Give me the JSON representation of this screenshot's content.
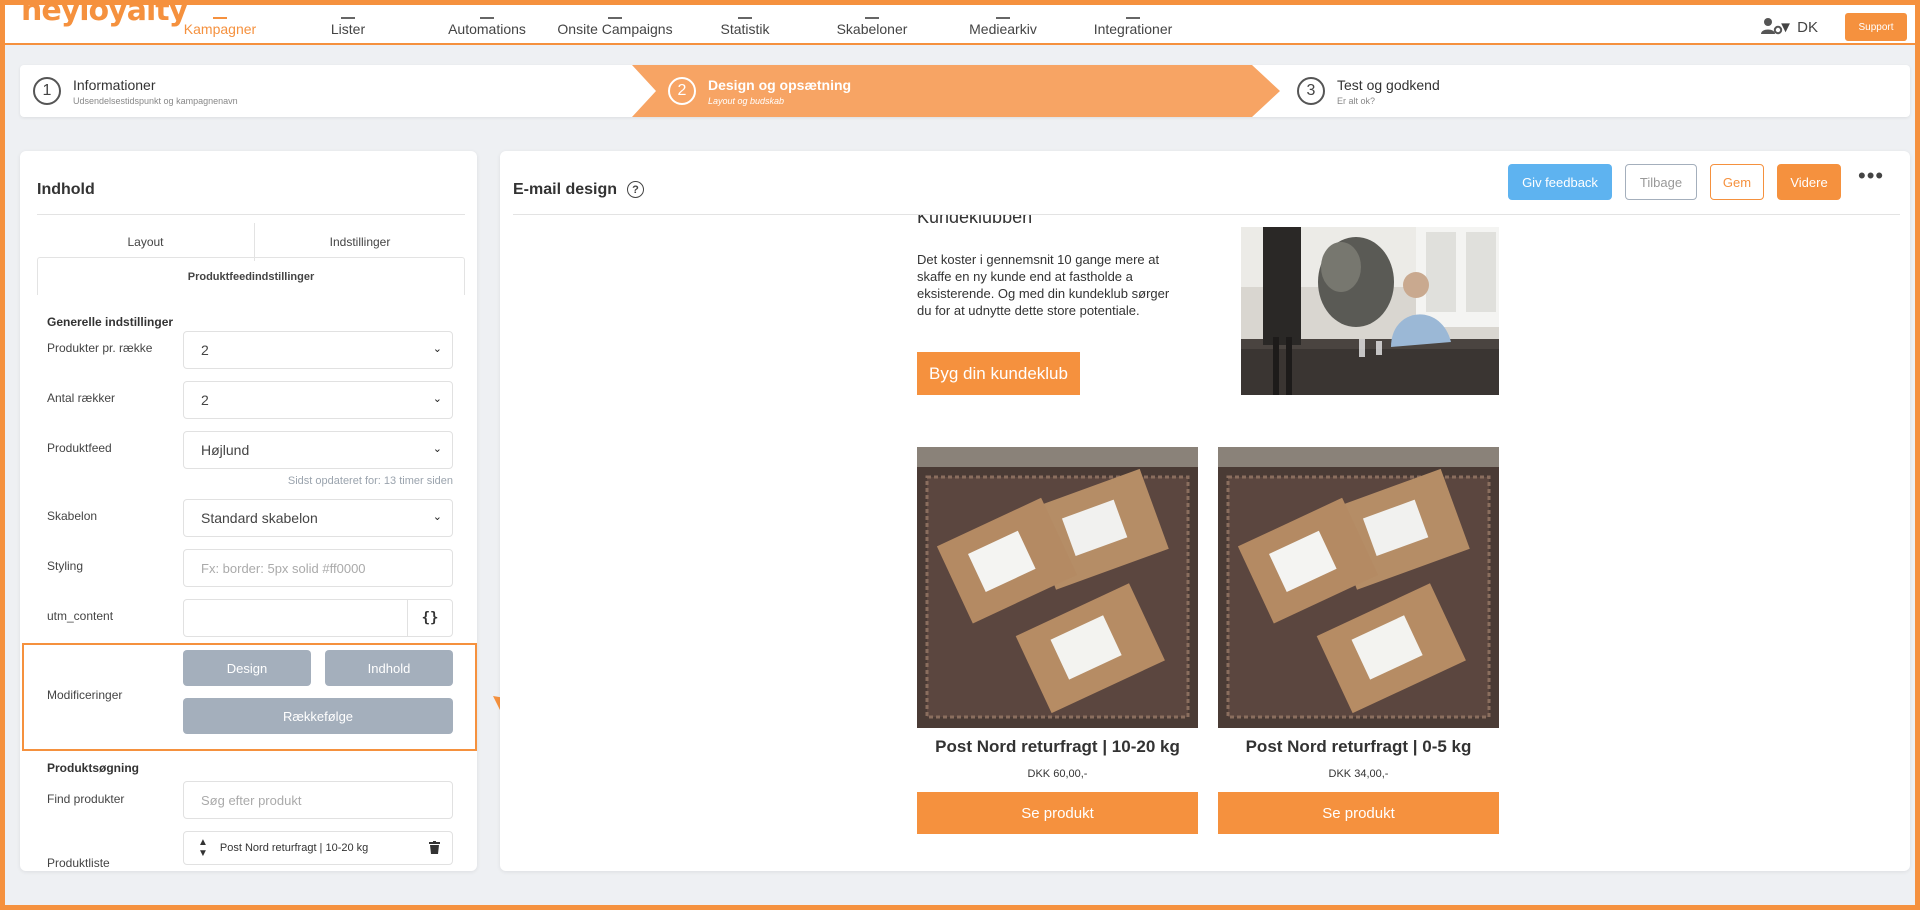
{
  "logo": "heyloyalty",
  "nav": {
    "items": [
      {
        "label": "Kampagner",
        "active": true
      },
      {
        "label": "Lister"
      },
      {
        "label": "Automations"
      },
      {
        "label": "Onsite Campaigns"
      },
      {
        "label": "Statistik"
      },
      {
        "label": "Skabeloner"
      },
      {
        "label": "Mediearkiv"
      },
      {
        "label": "Integrationer"
      }
    ],
    "user_icon": "user-cog-icon",
    "lang": "▼ DK",
    "support": "Support"
  },
  "steps": [
    {
      "num": "1",
      "title": "Informationer",
      "sub": "Udsendelsestidspunkt og kampagnenavn"
    },
    {
      "num": "2",
      "title": "Design og opsætning",
      "sub": "Layout og budskab",
      "active": true
    },
    {
      "num": "3",
      "title": "Test og godkend",
      "sub": "Er alt ok?"
    }
  ],
  "left": {
    "title": "Indhold",
    "tabs": [
      "Layout",
      "Indstillinger",
      "Produktfeedindstillinger"
    ],
    "general_title": "Generelle indstillinger",
    "fields": {
      "per_row": {
        "label": "Produkter pr. række",
        "value": "2"
      },
      "rows": {
        "label": "Antal rækker",
        "value": "2"
      },
      "feed": {
        "label": "Produktfeed",
        "value": "Højlund",
        "hint": "Sidst opdateret for: 13 timer siden"
      },
      "template": {
        "label": "Skabelon",
        "value": "Standard skabelon"
      },
      "styling": {
        "label": "Styling",
        "placeholder": "Fx: border: 5px solid #ff0000"
      },
      "utm": {
        "label": "utm_content",
        "value": "",
        "button": "{}"
      }
    },
    "modifications": {
      "label": "Modificeringer",
      "design": "Design",
      "content": "Indhold",
      "order": "Rækkefølge"
    },
    "search": {
      "title": "Produktsøgning",
      "label": "Find produkter",
      "placeholder": "Søg efter produkt"
    },
    "product_list": {
      "label": "Produktliste",
      "item": "Post Nord returfragt | 10-20 kg"
    }
  },
  "right": {
    "title": "E-mail design",
    "buttons": {
      "feedback": "Giv feedback",
      "back": "Tilbage",
      "save": "Gem",
      "next": "Videre",
      "more": "•••"
    },
    "email": {
      "cut_heading": "Kundeklubben",
      "body": "Det koster i gennemsnit 10 gange mere at skaffe en ny kunde end at fastholde a eksisterende. Og med din kundeklub sørger du for at udnytte dette store potentiale.",
      "cta": "Byg din kundeklub",
      "products": [
        {
          "name": "Post Nord returfragt | 10-20 kg",
          "price": "DKK 60,00,-",
          "button": "Se produkt"
        },
        {
          "name": "Post Nord returfragt | 0-5 kg",
          "price": "DKK 34,00,-",
          "button": "Se produkt"
        }
      ]
    }
  },
  "colors": {
    "accent": "#f5913e",
    "active_step": "#f7a464",
    "blue": "#5eb3f0",
    "grey_btn": "#a4afbc"
  }
}
